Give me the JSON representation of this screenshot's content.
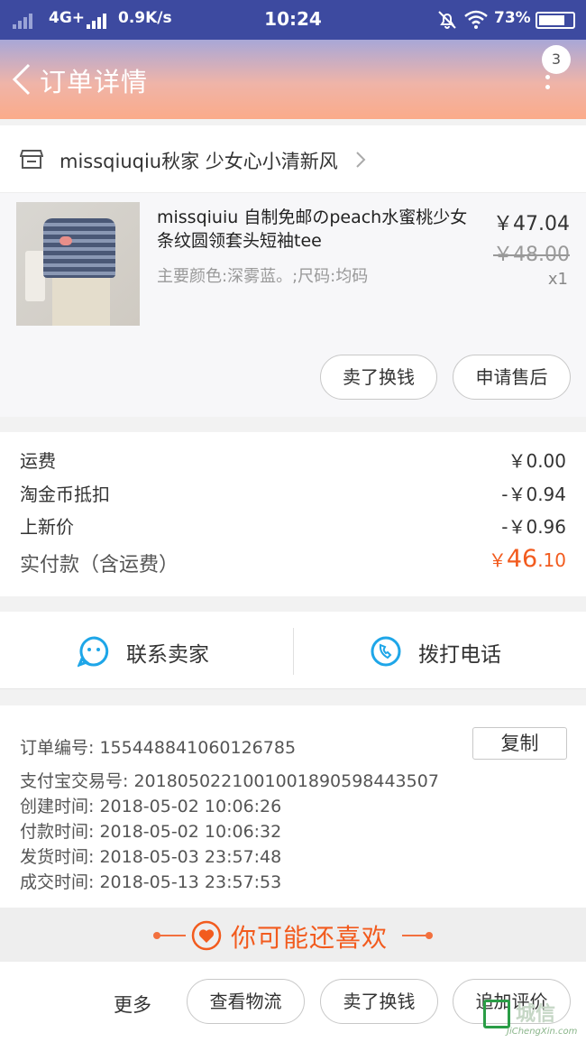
{
  "status_bar": {
    "network": "4G+",
    "speed": "0.9K/s",
    "time": "10:24",
    "battery": "73%",
    "battery_level": 0.73,
    "icons": [
      "signal-icon",
      "bell-off-icon",
      "wifi-icon",
      "battery-icon"
    ]
  },
  "header": {
    "title": "订单详情",
    "notification_count": "3",
    "icons": [
      "back-arrow-icon",
      "more-vertical-icon"
    ]
  },
  "shop": {
    "name": "missqiuqiu秋家 少女心小清新风",
    "icons": [
      "store-icon",
      "chevron-right-icon"
    ]
  },
  "item": {
    "name": "missqiuiu 自制免邮のpeach水蜜桃少女条纹圆领套头短袖tee",
    "spec": "主要颜色:深雾蓝。;尺码:均码",
    "price": "￥47.04",
    "original_price": "￥48.00",
    "quantity": "x1",
    "buttons": {
      "sell": "卖了换钱",
      "after_sale": "申请售后"
    }
  },
  "cost": {
    "rows": [
      {
        "label": "运费",
        "value": "￥0.00"
      },
      {
        "label": "淘金币抵扣",
        "value": "-￥0.94"
      },
      {
        "label": "上新价",
        "value": "-￥0.96"
      }
    ],
    "paid_label": "实付款（含运费）",
    "paid_currency": "￥",
    "paid_integer": "46",
    "paid_decimal": ".10",
    "accent_color": "#f25b1e"
  },
  "contact": {
    "seller": "联系卖家",
    "phone": "拨打电话",
    "icon_color": "#1ea6e8"
  },
  "order_info": {
    "order_no": "订单编号:   1554488410601267​85",
    "copy": "复制",
    "alipay": "支付宝交易号:   2018050221001001890598443507",
    "created": "创建时间:   2018-05-02 10:06:26",
    "paid": "付款时间:   2018-05-02 10:06:32",
    "shipped": "发货时间:   2018-05-03 23:57:48",
    "completed": "成交时间:   2018-05-13 23:57:53"
  },
  "guess": {
    "text": "你可能还喜欢"
  },
  "bottom": {
    "more": "更多",
    "logistics": "查看物流",
    "sell": "卖了换钱",
    "review": "追加评价"
  },
  "watermark": {
    "cn": "城信",
    "en": "JiChengXin.com"
  }
}
